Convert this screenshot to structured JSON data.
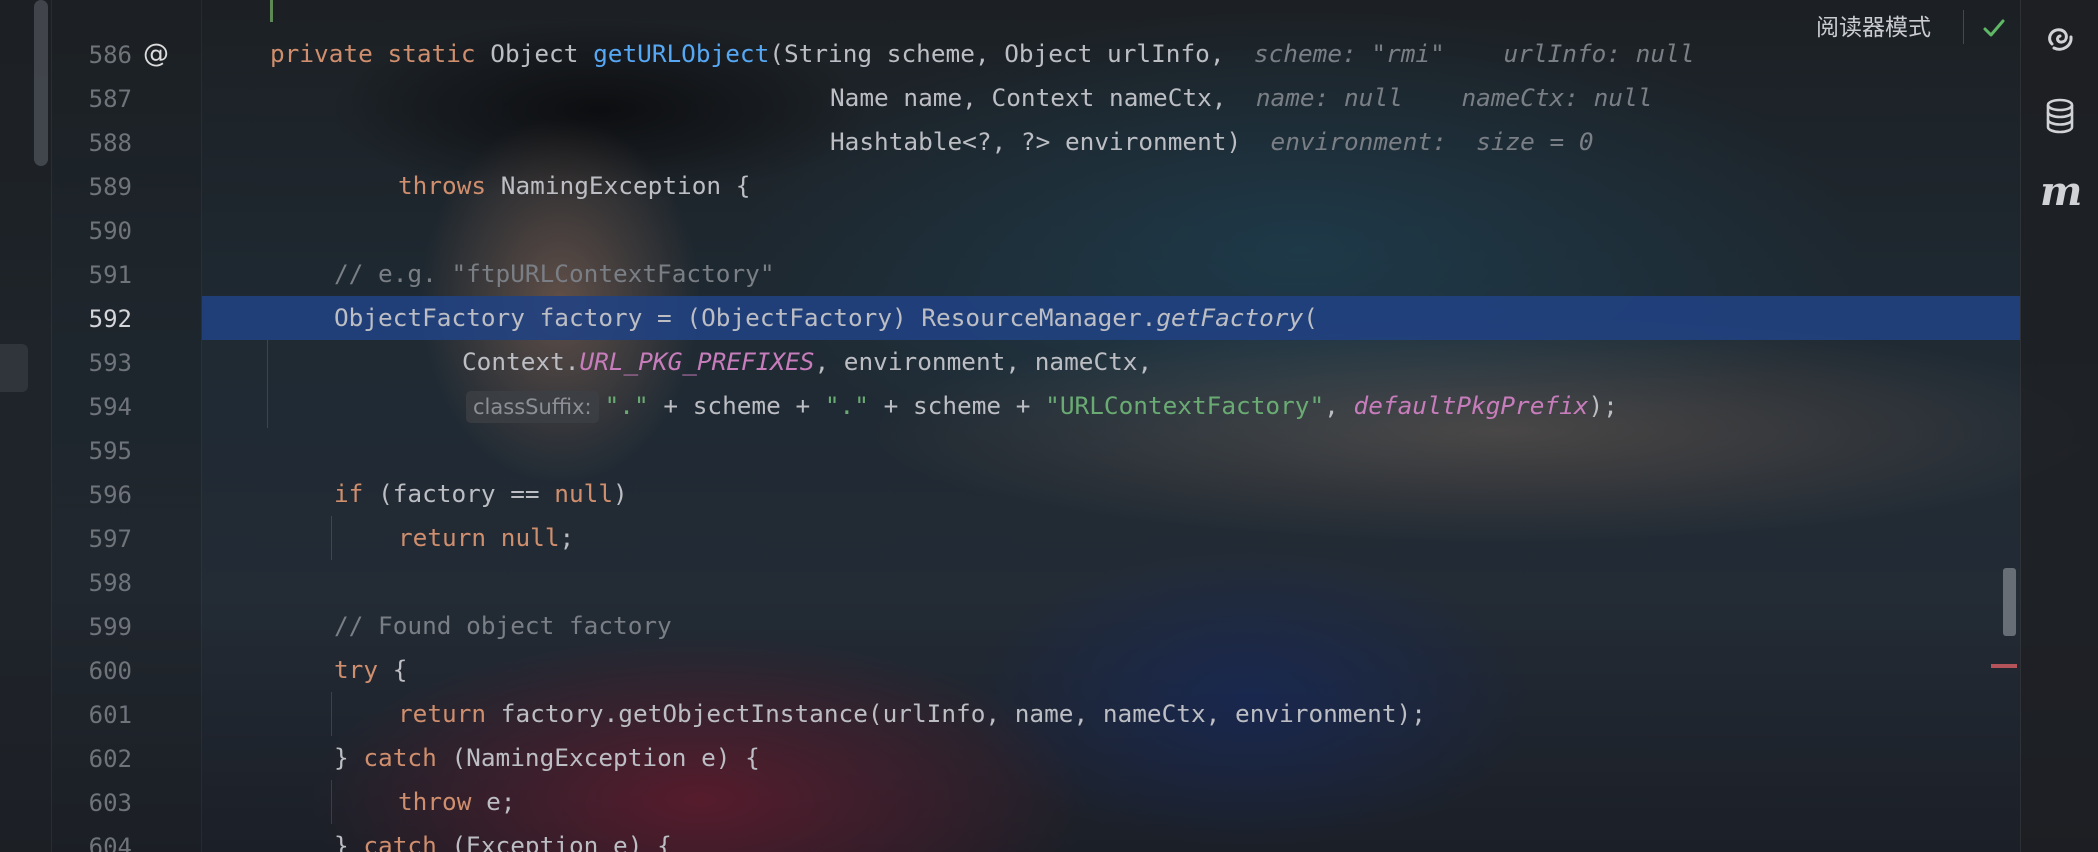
{
  "editor": {
    "reader_mode_label": "阅读器模式",
    "icons": {
      "override": "@",
      "check": "check-icon",
      "ai": "ai-assistant-icon",
      "database": "database-icon",
      "maven": "maven-icon"
    },
    "line_numbers": [
      "586",
      "587",
      "588",
      "589",
      "590",
      "591",
      "592",
      "593",
      "594",
      "595",
      "596",
      "597",
      "598",
      "599",
      "600",
      "601",
      "602",
      "603",
      "604"
    ],
    "active_line": "592",
    "colors": {
      "keyword": "#cf8e6d",
      "function": "#56a8f5",
      "comment": "#7a7e85",
      "string": "#6aab73",
      "field": "#c77dbb",
      "highlight": "#214283"
    }
  },
  "code": {
    "l586": {
      "kw1": "private static ",
      "type": "Object ",
      "fn": "getURLObject",
      "rest": "(String scheme, Object urlInfo,",
      "hint": "scheme: \"rmi\"    urlInfo: null"
    },
    "l587": {
      "text": "Name name, Context nameCtx,",
      "hint": "name: null    nameCtx: null"
    },
    "l588": {
      "text": "Hashtable<?, ?> environment)",
      "hint": "environment:  size = 0"
    },
    "l589": {
      "kw": "throws ",
      "text": "NamingException {"
    },
    "l591": {
      "comment": "// e.g. \"ftpURLContextFactory\""
    },
    "l592": {
      "text": "ObjectFactory factory = (ObjectFactory) ResourceManager.",
      "method": "getFactory",
      "end": "("
    },
    "l593": {
      "text": "Context.",
      "field": "URL_PKG_PREFIXES",
      "rest": ", environment, nameCtx,"
    },
    "l594": {
      "param_hint": "classSuffix:",
      "s1": "\".\"",
      "p1": " + scheme + ",
      "s2": "\".\"",
      "p2": " + scheme + ",
      "s3": "\"URLContextFactory\"",
      "p3": ", ",
      "field": "defaultPkgPrefix",
      "end": ");"
    },
    "l596": {
      "kw": "if ",
      "text": "(factory == ",
      "kw2": "null",
      "end": ")"
    },
    "l597": {
      "kw": "return null",
      "end": ";"
    },
    "l599": {
      "comment": "// Found object factory"
    },
    "l600": {
      "kw": "try ",
      "end": "{"
    },
    "l601": {
      "kw": "return ",
      "text": "factory.getObjectInstance(urlInfo, name, nameCtx, environment);"
    },
    "l602": {
      "pre": "} ",
      "kw": "catch ",
      "text": "(NamingException e) {"
    },
    "l603": {
      "kw": "throw ",
      "text": "e;"
    },
    "l604": {
      "pre": "} ",
      "kw": "catch ",
      "text": "(Exception e) {"
    }
  }
}
